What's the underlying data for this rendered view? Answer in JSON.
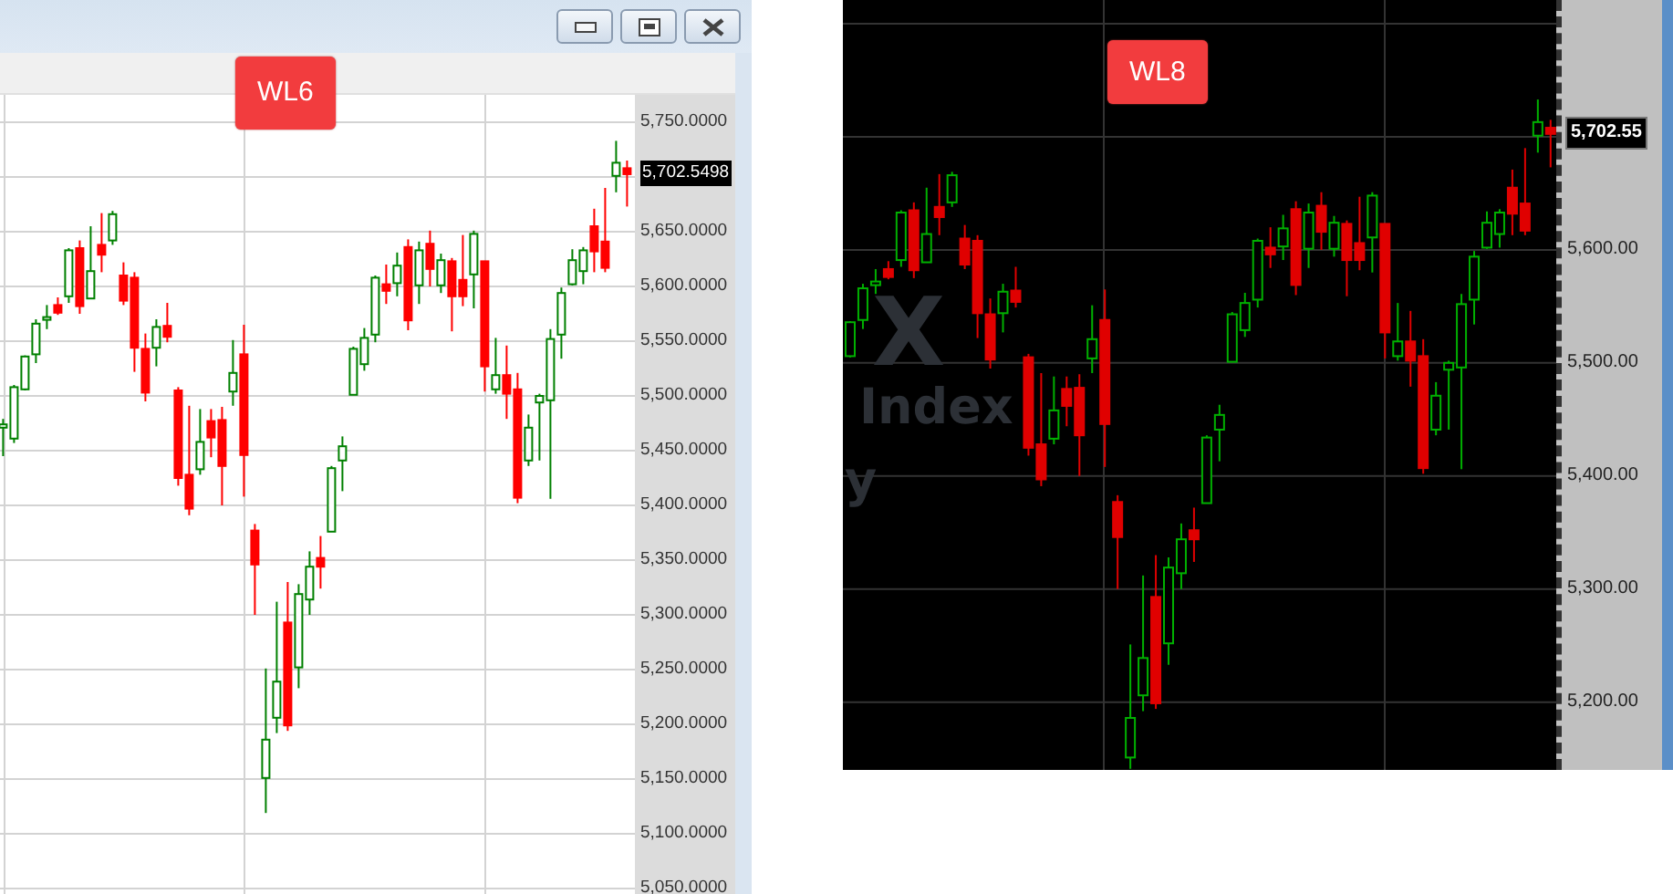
{
  "left_window": {
    "badge": "WL6",
    "current_price": "5,702.5498",
    "chart_data": {
      "type": "candlestick",
      "grid": true,
      "ylim": [
        5045,
        5775
      ],
      "ohlc": [
        [
          5471,
          5479,
          5445,
          5474
        ],
        [
          5461,
          5510,
          5457,
          5508
        ],
        [
          5506,
          5537,
          5505,
          5536
        ],
        [
          5538,
          5570,
          5530,
          5566
        ],
        [
          5571,
          5583,
          5561,
          5572
        ],
        [
          5583,
          5590,
          5574,
          5576
        ],
        [
          5591,
          5635,
          5585,
          5633
        ],
        [
          5635,
          5642,
          5575,
          5582
        ],
        [
          5589,
          5655,
          5589,
          5614
        ],
        [
          5638,
          5667,
          5613,
          5629
        ],
        [
          5642,
          5669,
          5638,
          5666
        ],
        [
          5610,
          5622,
          5583,
          5587
        ],
        [
          5608,
          5613,
          5522,
          5544
        ],
        [
          5543,
          5557,
          5495,
          5503
        ],
        [
          5544,
          5570,
          5527,
          5563
        ],
        [
          5564,
          5585,
          5549,
          5554
        ],
        [
          5505,
          5508,
          5418,
          5425
        ],
        [
          5428,
          5491,
          5391,
          5397
        ],
        [
          5433,
          5488,
          5428,
          5458
        ],
        [
          5477,
          5488,
          5444,
          5462
        ],
        [
          5478,
          5490,
          5400,
          5436
        ],
        [
          5504,
          5551,
          5491,
          5521
        ],
        [
          5538,
          5565,
          5408,
          5446
        ],
        [
          5377,
          5383,
          5300,
          5346
        ],
        [
          5151,
          5251,
          5119,
          5186
        ],
        [
          5206,
          5312,
          5192,
          5239
        ],
        [
          5293,
          5330,
          5194,
          5199
        ],
        [
          5252,
          5328,
          5233,
          5319
        ],
        [
          5314,
          5358,
          5300,
          5344
        ],
        [
          5352,
          5372,
          5324,
          5344
        ],
        [
          5376,
          5436,
          5376,
          5434
        ],
        [
          5441,
          5463,
          5413,
          5454
        ],
        [
          5501,
          5545,
          5501,
          5543
        ],
        [
          5529,
          5562,
          5523,
          5553
        ],
        [
          5556,
          5610,
          5549,
          5608
        ],
        [
          5602,
          5620,
          5584,
          5596
        ],
        [
          5603,
          5631,
          5591,
          5619
        ],
        [
          5636,
          5643,
          5560,
          5569
        ],
        [
          5601,
          5641,
          5584,
          5633
        ],
        [
          5639,
          5651,
          5600,
          5616
        ],
        [
          5601,
          5630,
          5594,
          5624
        ],
        [
          5623,
          5626,
          5559,
          5591
        ],
        [
          5606,
          5647,
          5582,
          5591
        ],
        [
          5611,
          5651,
          5580,
          5648
        ],
        [
          5623,
          5623,
          5504,
          5527
        ],
        [
          5506,
          5553,
          5502,
          5519
        ],
        [
          5519,
          5546,
          5479,
          5502
        ],
        [
          5506,
          5521,
          5402,
          5407
        ],
        [
          5441,
          5483,
          5436,
          5471
        ],
        [
          5494,
          5502,
          5441,
          5500
        ],
        [
          5496,
          5561,
          5406,
          5552
        ],
        [
          5556,
          5599,
          5534,
          5594
        ],
        [
          5602,
          5634,
          5601,
          5624
        ],
        [
          5614,
          5636,
          5602,
          5633
        ],
        [
          5655,
          5671,
          5613,
          5632
        ],
        [
          5641,
          5690,
          5613,
          5617
        ],
        [
          5701,
          5733,
          5686,
          5713
        ],
        [
          5708,
          5715,
          5673,
          5702.55
        ]
      ],
      "yticks": [
        {
          "value": 5750,
          "label": "5,750.0000"
        },
        {
          "value": 5650,
          "label": "5,650.0000"
        },
        {
          "value": 5600,
          "label": "5,600.0000"
        },
        {
          "value": 5550,
          "label": "5,550.0000"
        },
        {
          "value": 5500,
          "label": "5,500.0000"
        },
        {
          "value": 5450,
          "label": "5,450.0000"
        },
        {
          "value": 5400,
          "label": "5,400.0000"
        },
        {
          "value": 5350,
          "label": "5,350.0000"
        },
        {
          "value": 5300,
          "label": "5,300.0000"
        },
        {
          "value": 5250,
          "label": "5,250.0000"
        },
        {
          "value": 5200,
          "label": "5,200.0000"
        },
        {
          "value": 5150,
          "label": "5,150.0000"
        },
        {
          "value": 5100,
          "label": "5,100.0000"
        },
        {
          "value": 5050,
          "label": "5,050.0000"
        }
      ]
    }
  },
  "right_chart": {
    "badge": "WL8",
    "watermark": [
      "X",
      "Index",
      "y"
    ],
    "current_price": "5,702.55",
    "chart_data": {
      "type": "candlestick",
      "grid": true,
      "ylim": [
        5140,
        5821
      ],
      "ohlc": [
        [
          5506,
          5537,
          5505,
          5536
        ],
        [
          5538,
          5570,
          5530,
          5566
        ],
        [
          5571,
          5583,
          5561,
          5572
        ],
        [
          5583,
          5590,
          5574,
          5576
        ],
        [
          5591,
          5635,
          5585,
          5633
        ],
        [
          5635,
          5642,
          5575,
          5582
        ],
        [
          5589,
          5655,
          5589,
          5614
        ],
        [
          5638,
          5667,
          5613,
          5629
        ],
        [
          5642,
          5669,
          5638,
          5666
        ],
        [
          5610,
          5622,
          5583,
          5587
        ],
        [
          5608,
          5613,
          5522,
          5544
        ],
        [
          5543,
          5557,
          5495,
          5503
        ],
        [
          5544,
          5570,
          5527,
          5563
        ],
        [
          5564,
          5585,
          5549,
          5554
        ],
        [
          5505,
          5508,
          5418,
          5425
        ],
        [
          5428,
          5491,
          5391,
          5397
        ],
        [
          5433,
          5488,
          5428,
          5458
        ],
        [
          5477,
          5488,
          5444,
          5462
        ],
        [
          5478,
          5490,
          5400,
          5436
        ],
        [
          5504,
          5551,
          5491,
          5521
        ],
        [
          5538,
          5565,
          5408,
          5446
        ],
        [
          5377,
          5383,
          5300,
          5346
        ],
        [
          5151,
          5251,
          5141,
          5186
        ],
        [
          5206,
          5312,
          5192,
          5239
        ],
        [
          5293,
          5330,
          5194,
          5199
        ],
        [
          5252,
          5328,
          5233,
          5319
        ],
        [
          5314,
          5358,
          5300,
          5344
        ],
        [
          5352,
          5372,
          5324,
          5344
        ],
        [
          5376,
          5436,
          5376,
          5434
        ],
        [
          5441,
          5463,
          5413,
          5454
        ],
        [
          5501,
          5545,
          5501,
          5543
        ],
        [
          5529,
          5562,
          5523,
          5553
        ],
        [
          5556,
          5610,
          5549,
          5608
        ],
        [
          5602,
          5620,
          5584,
          5596
        ],
        [
          5603,
          5631,
          5591,
          5619
        ],
        [
          5636,
          5643,
          5560,
          5569
        ],
        [
          5601,
          5641,
          5584,
          5633
        ],
        [
          5639,
          5651,
          5600,
          5616
        ],
        [
          5601,
          5630,
          5594,
          5624
        ],
        [
          5623,
          5626,
          5559,
          5591
        ],
        [
          5606,
          5647,
          5582,
          5591
        ],
        [
          5611,
          5651,
          5580,
          5648
        ],
        [
          5623,
          5623,
          5504,
          5527
        ],
        [
          5506,
          5553,
          5502,
          5519
        ],
        [
          5519,
          5546,
          5479,
          5502
        ],
        [
          5506,
          5521,
          5402,
          5407
        ],
        [
          5441,
          5483,
          5436,
          5471
        ],
        [
          5494,
          5502,
          5441,
          5500
        ],
        [
          5496,
          5561,
          5406,
          5552
        ],
        [
          5556,
          5599,
          5534,
          5594
        ],
        [
          5602,
          5634,
          5601,
          5624
        ],
        [
          5614,
          5636,
          5602,
          5633
        ],
        [
          5655,
          5671,
          5613,
          5632
        ],
        [
          5641,
          5690,
          5613,
          5617
        ],
        [
          5701,
          5733,
          5686,
          5713
        ],
        [
          5708,
          5715,
          5673,
          5702.55
        ]
      ],
      "yticks": [
        {
          "value": 5600,
          "label": "5,600.00"
        },
        {
          "value": 5500,
          "label": "5,500.00"
        },
        {
          "value": 5400,
          "label": "5,400.00"
        },
        {
          "value": 5300,
          "label": "5,300.00"
        },
        {
          "value": 5200,
          "label": "5,200.00"
        }
      ]
    }
  }
}
